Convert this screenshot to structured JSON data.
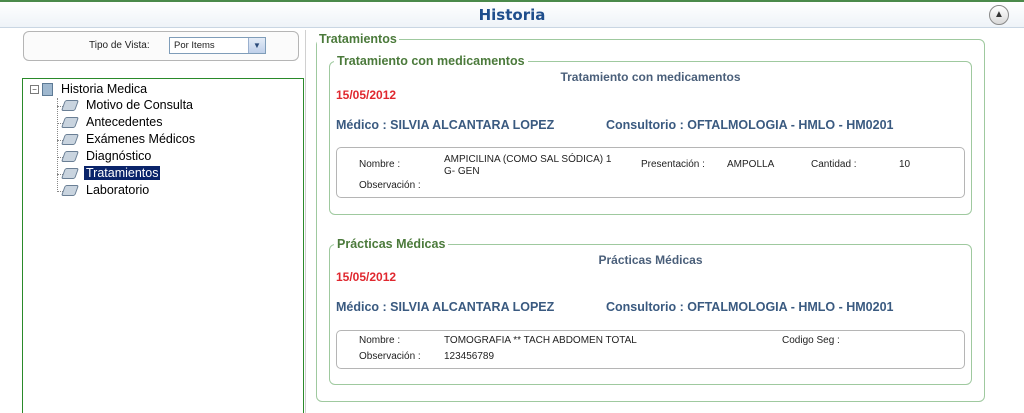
{
  "header": {
    "title": "Historia",
    "collapse_icon": "chevron-up-icon"
  },
  "view": {
    "label": "Tipo de Vista:",
    "selected": "Por Items"
  },
  "tree": {
    "root": "Historia Medica",
    "items": [
      {
        "label": "Motivo de Consulta",
        "selected": false
      },
      {
        "label": "Antecedentes",
        "selected": false
      },
      {
        "label": "Exámenes Médicos",
        "selected": false
      },
      {
        "label": "Diagnóstico",
        "selected": false
      },
      {
        "label": "Tratamientos",
        "selected": true
      },
      {
        "label": "Laboratorio",
        "selected": false
      }
    ]
  },
  "main": {
    "legend": "Tratamientos",
    "medicamentos": {
      "legend": "Tratamiento con medicamentos",
      "title": "Tratamiento con medicamentos",
      "date": "15/05/2012",
      "doctor": "Médico : SILVIA ALCANTARA LOPEZ",
      "consultorio": "Consultorio : OFTALMOLOGIA - HMLO - HM0201",
      "nombre_label": "Nombre :",
      "nombre_value_1": "AMPICILINA (COMO SAL SÓDICA) 1",
      "nombre_value_2": "G- GEN",
      "presentacion_label": "Presentación :",
      "presentacion_value": "AMPOLLA",
      "cantidad_label": "Cantidad :",
      "cantidad_value": "10",
      "observacion_label": "Observación :"
    },
    "practicas": {
      "legend": "Prácticas Médicas",
      "title": "Prácticas Médicas",
      "date": "15/05/2012",
      "doctor": "Médico : SILVIA ALCANTARA LOPEZ",
      "consultorio": "Consultorio : OFTALMOLOGIA - HMLO - HM0201",
      "nombre_label": "Nombre :",
      "nombre_value": "TOMOGRAFIA ** TACH ABDOMEN TOTAL",
      "codigo_label": "Codigo Seg :",
      "observacion_label": "Observación :",
      "observacion_value": "123456789"
    }
  }
}
